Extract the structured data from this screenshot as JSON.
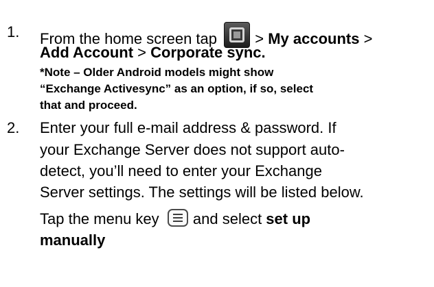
{
  "steps": [
    {
      "number": "1.",
      "line1_prefix": "From the home screen tap ",
      "line1_sep1": " > ",
      "line1_my_accounts": "My accounts",
      "line1_sep2": " >",
      "line2_add_account": "Add Account",
      "line2_sep": " > ",
      "line2_corporate_sync": "Corporate sync.",
      "note_lines": [
        "*Note – Older Android models might show",
        "“Exchange Activesync” as an option, if so, select",
        "that and proceed."
      ]
    },
    {
      "number": "2.",
      "lines": [
        "Enter your full e-mail address & password. If",
        "your Exchange Server does not support auto-",
        "detect, you’ll need to enter your Exchange",
        "Server settings. The settings will be listed below."
      ],
      "tap_prefix": "Tap the menu key ",
      "tap_middle": " and select ",
      "tap_bold": "set up",
      "tap_bold_line2": "manually"
    }
  ],
  "icons": {
    "home": "home-button-icon",
    "menu": "menu-key-icon"
  }
}
